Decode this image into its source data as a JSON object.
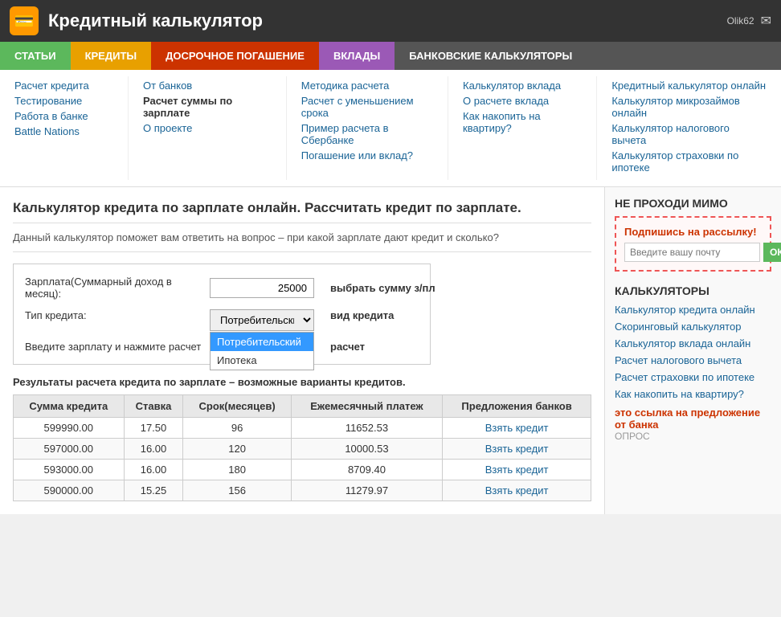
{
  "header": {
    "icon": "💳",
    "title": "Кредитный калькулятор",
    "user": "Olik62",
    "envelope": "✉"
  },
  "navbar": {
    "items": [
      {
        "label": "СТАТЬИ",
        "class": "green"
      },
      {
        "label": "КРЕДИТЫ",
        "class": "orange"
      },
      {
        "label": "ДОСРОЧНОЕ ПОГАШЕНИЕ",
        "class": "red"
      },
      {
        "label": "ВКЛАДЫ",
        "class": "purple"
      },
      {
        "label": "БАНКОВСКИЕ КАЛЬКУЛЯТОРЫ",
        "class": "darkgray"
      }
    ]
  },
  "subnav": {
    "cols": [
      {
        "links": [
          {
            "text": "Расчет кредита",
            "bold": false
          },
          {
            "text": "Тестирование",
            "bold": false
          },
          {
            "text": "Работа в банке",
            "bold": false
          },
          {
            "text": "Battle Nations",
            "bold": false
          }
        ]
      },
      {
        "links": [
          {
            "text": "От банков",
            "bold": false
          },
          {
            "text": "Расчет суммы по зарплате",
            "bold": true
          },
          {
            "text": "О проекте",
            "bold": false
          }
        ]
      },
      {
        "links": [
          {
            "text": "Методика расчета",
            "bold": false
          },
          {
            "text": "Расчет с уменьшением срока",
            "bold": false
          },
          {
            "text": "Пример расчета в Сбербанке",
            "bold": false
          },
          {
            "text": "Погашение или вклад?",
            "bold": false
          }
        ]
      },
      {
        "links": [
          {
            "text": "Калькулятор вклада",
            "bold": false
          },
          {
            "text": "О расчете вклада",
            "bold": false
          },
          {
            "text": "Как накопить на квартиру?",
            "bold": false
          }
        ]
      },
      {
        "links": [
          {
            "text": "Кредитный калькулятор онлайн",
            "bold": false
          },
          {
            "text": "Калькулятор микрозаймов онлайн",
            "bold": false
          },
          {
            "text": "Калькулятор налогового вычета",
            "bold": false
          },
          {
            "text": "Калькулятор страховки по ипотеке",
            "bold": false
          }
        ]
      }
    ]
  },
  "page": {
    "title": "Калькулятор кредита по зарплате онлайн. Рассчитать кредит по зарплате.",
    "desc": "Данный калькулятор поможет вам ответить на вопрос – при какой зарплате дают кредит и сколько?"
  },
  "form": {
    "salary_label": "Зарплата(Суммарный доход в месяц):",
    "salary_value": "25000",
    "credit_type_label": "Тип кредита:",
    "credit_type_value": "Потребительский",
    "hint_salary": "выбрать сумму з/пл",
    "hint_type": "вид кредита",
    "note": "Введите зарплату и нажмите расчет",
    "hint_calc": "расчет",
    "dropdown_options": [
      {
        "label": "Потребительский",
        "selected": true
      },
      {
        "label": "Ипотека",
        "selected": false
      }
    ]
  },
  "results": {
    "title": "Результаты расчета кредита по зарплате – возможные варианты кредитов.",
    "headers": [
      "Сумма кредита",
      "Ставка",
      "Срок(месяцев)",
      "Ежемесячный платеж",
      "Предложения банков"
    ],
    "rows": [
      {
        "amount": "599990.00",
        "rate": "17.50",
        "term": "96",
        "payment": "11652.53",
        "link": "Взять кредит"
      },
      {
        "amount": "597000.00",
        "rate": "16.00",
        "term": "120",
        "payment": "10000.53",
        "link": "Взять кредит"
      },
      {
        "amount": "593000.00",
        "rate": "16.00",
        "term": "180",
        "payment": "8709.40",
        "link": "Взять кредит"
      },
      {
        "amount": "590000.00",
        "rate": "15.25",
        "term": "156",
        "payment": "11279.97",
        "link": "Взять кредит"
      }
    ]
  },
  "sidebar": {
    "promo_title": "НЕ ПРОХОДИ МИМО",
    "subscribe_label": "Подпишись на рассылку!",
    "subscribe_placeholder": "Введите вашу почту",
    "subscribe_btn": "ОК",
    "calc_title": "КАЛЬКУЛЯТОРЫ",
    "calc_links": [
      "Калькулятор кредита онлайн",
      "Скоринговый калькулятор",
      "Калькулятор вклада онлайн",
      "Расчет налогового вычета",
      "Расчет страховки по ипотеке",
      "Как накопить на квартиру?"
    ],
    "note": "это ссылка на предложение от банка",
    "note2": "ОПРОС"
  }
}
